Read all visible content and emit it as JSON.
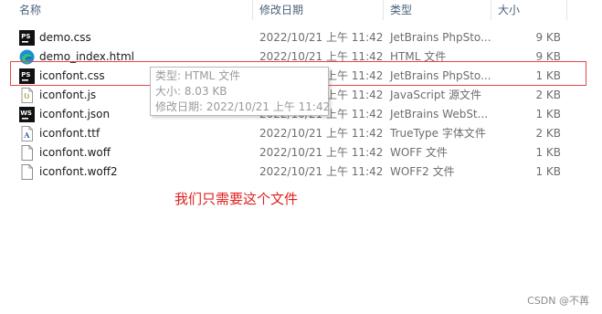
{
  "columns": {
    "name": "名称",
    "date": "修改日期",
    "type": "类型",
    "size": "大小"
  },
  "files": [
    {
      "name": "demo.css",
      "date": "2022/10/21 上午 11:42",
      "type": "JetBrains PhpSto...",
      "size": "9 KB",
      "icon": "phpstorm-icon"
    },
    {
      "name": "demo_index.html",
      "date": "2022/10/21 上午 11:42",
      "type": "HTML 文件",
      "size": "9 KB",
      "icon": "edge-browser-icon"
    },
    {
      "name": "iconfont.css",
      "date": "2022/10/21 上午 11:42",
      "type": "JetBrains PhpSto...",
      "size": "1 KB",
      "icon": "phpstorm-icon"
    },
    {
      "name": "iconfont.js",
      "date": "2022/10/21 上午 11:42",
      "type": "JavaScript 源文件",
      "size": "2 KB",
      "icon": "javascript-file-icon"
    },
    {
      "name": "iconfont.json",
      "date": "2022/10/21 上午 11:42",
      "type": "JetBrains WebSt...",
      "size": "1 KB",
      "icon": "webstorm-icon"
    },
    {
      "name": "iconfont.ttf",
      "date": "2022/10/21 上午 11:42",
      "type": "TrueType 字体文件",
      "size": "2 KB",
      "icon": "font-file-icon"
    },
    {
      "name": "iconfont.woff",
      "date": "2022/10/21 上午 11:42",
      "type": "WOFF 文件",
      "size": "1 KB",
      "icon": "blank-file-icon"
    },
    {
      "name": "iconfont.woff2",
      "date": "2022/10/21 上午 11:42",
      "type": "WOFF2 文件",
      "size": "1 KB",
      "icon": "blank-file-icon"
    }
  ],
  "tooltip": {
    "type_line": "类型: HTML 文件",
    "size_line": "大小: 8.03 KB",
    "date_line": "修改日期: 2022/10/21 上午 11:42"
  },
  "annotation": "我们只需要这个文件",
  "watermark": "CSDN @不苒",
  "colors": {
    "highlight_border": "#e04848",
    "annotation_text": "#e02020",
    "header_text": "#4c607a"
  }
}
